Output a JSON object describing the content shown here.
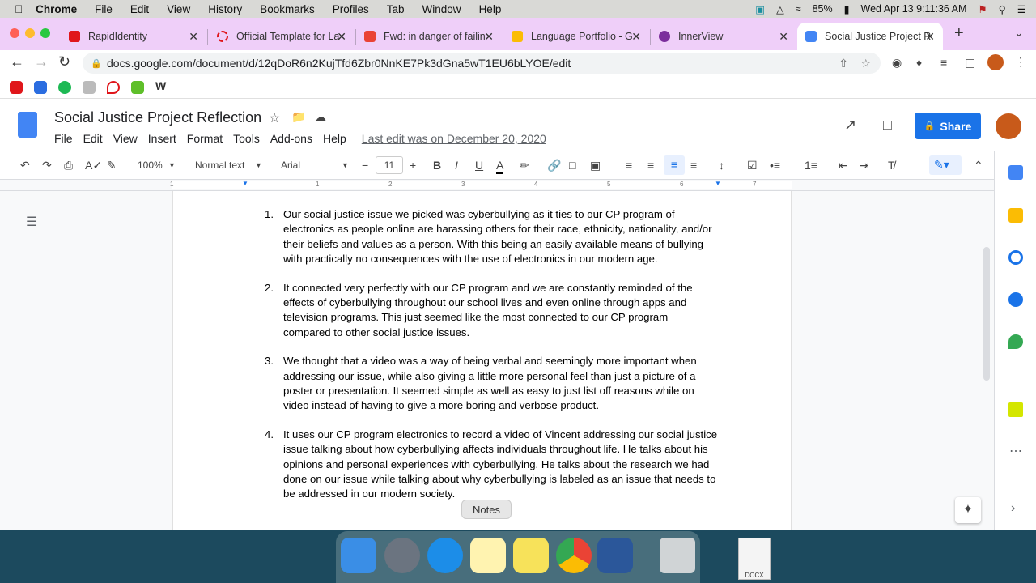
{
  "menubar": {
    "app": "Chrome",
    "items": [
      "File",
      "Edit",
      "View",
      "History",
      "Bookmarks",
      "Profiles",
      "Tab",
      "Window",
      "Help"
    ],
    "battery": "85%",
    "datetime": "Wed Apr 13  9:11:36 AM"
  },
  "tabs": [
    {
      "title": "RapidIdentity",
      "color": "#e0161b"
    },
    {
      "title": "Official Template for La",
      "color": "#e0161b"
    },
    {
      "title": "Fwd: in danger of failin",
      "color": "#ea4335"
    },
    {
      "title": "Language Portfolio - G",
      "color": "#fbbc04"
    },
    {
      "title": "InnerView",
      "color": "#7b2d9c"
    },
    {
      "title": "Social Justice Project R",
      "color": "#4285f4",
      "active": true
    }
  ],
  "address": {
    "url": "docs.google.com/document/d/12qDoR6n2KujTfd6Zbr0NnKE7Pk3dGna5wT1EU6bLYOE/edit"
  },
  "doc": {
    "title": "Social Justice Project Reflection",
    "menu": [
      "File",
      "Edit",
      "View",
      "Insert",
      "Format",
      "Tools",
      "Add-ons",
      "Help"
    ],
    "last_edit": "Last edit was on December 20, 2020",
    "share": "Share"
  },
  "toolbar": {
    "zoom": "100%",
    "style": "Normal text",
    "font": "Arial",
    "size": "11"
  },
  "ruler": [
    "1",
    "1",
    "2",
    "3",
    "4",
    "5",
    "6",
    "7"
  ],
  "items": [
    {
      "n": "1.",
      "text": "Our social justice issue we picked was cyberbullying as it ties to our CP program of electronics as people online are harassing others for their race, ethnicity, nationality, and/or their beliefs and values as a person. With this being an easily available means of bullying with practically no consequences with the use of electronics in our modern age."
    },
    {
      "n": "2.",
      "text": "It connected very perfectly with our CP program and we are constantly reminded of the effects of cyberbullying throughout our school lives and even online through apps and television programs. This just seemed like the most connected to our CP program compared to other social justice issues."
    },
    {
      "n": "3.",
      "text": "We thought that a video was a way of being verbal and seemingly more important when addressing our issue, while also giving a little more personal feel than just a picture of a poster or presentation. It seemed simple as well as easy to just list off reasons while on video instead of having to give a more boring and verbose product."
    },
    {
      "n": "4.",
      "text": "It uses our CP program electronics to record a video of Vincent addressing our social justice issue talking about how cyberbullying affects individuals throughout life. He talks about his opinions and personal experiences with cyberbullying. He talks about the research we had done on our issue while talking about why cyberbullying is labeled as an issue that needs to be addressed in our modern society."
    }
  ],
  "dock": {
    "tooltip": "Notes",
    "docx_label": "DOCX"
  },
  "colors": {
    "tabstrip": "#efcff9",
    "share": "#1a73e8"
  }
}
